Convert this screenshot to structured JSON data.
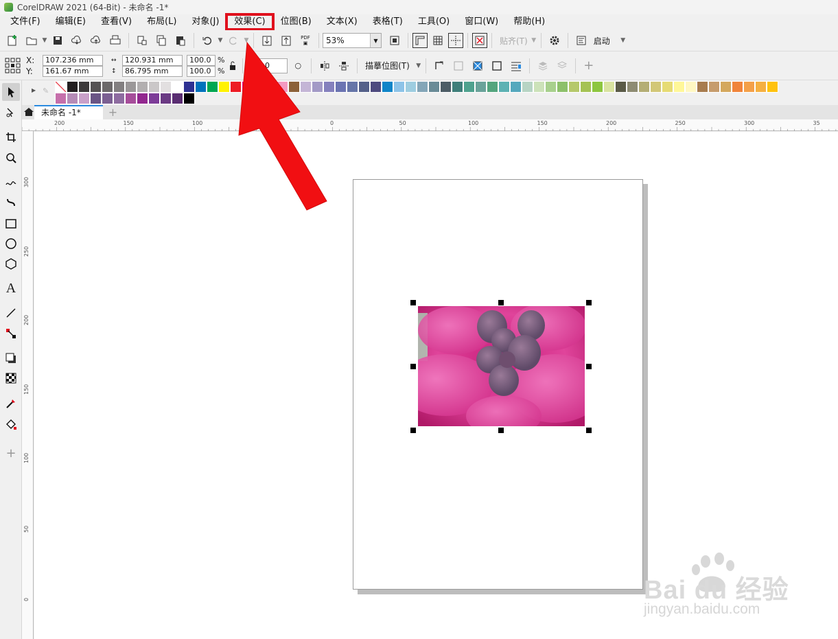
{
  "window": {
    "title": "CorelDRAW 2021 (64-Bit) - 未命名 -1*"
  },
  "menu": [
    {
      "label": "文件(F)"
    },
    {
      "label": "编辑(E)"
    },
    {
      "label": "查看(V)"
    },
    {
      "label": "布局(L)"
    },
    {
      "label": "对象(J)"
    },
    {
      "label": "效果(C)",
      "highlighted": true
    },
    {
      "label": "位图(B)"
    },
    {
      "label": "文本(X)"
    },
    {
      "label": "表格(T)"
    },
    {
      "label": "工具(O)"
    },
    {
      "label": "窗口(W)"
    },
    {
      "label": "帮助(H)"
    }
  ],
  "toolbar": {
    "zoom": "53%",
    "pdf_label": "PDF",
    "snap_label": "贴齐(T)",
    "launch_label": "启动"
  },
  "property_bar": {
    "x_label": "X:",
    "x": "107.236 mm",
    "y_label": "Y:",
    "y": "161.67 mm",
    "width": "120.931 mm",
    "height": "86.795 mm",
    "scale_w": "100.0",
    "scale_h": "100.0",
    "percent": "%",
    "rotation": "0.0",
    "trace_label": "描摹位图(T)"
  },
  "document_tab": {
    "label": "未命名 -1*"
  },
  "ruler": {
    "h_ticks": [
      "200",
      "150",
      "100",
      "50",
      "0",
      "50",
      "100",
      "150",
      "200",
      "250",
      "300",
      "35"
    ],
    "v_ticks": [
      "300",
      "250",
      "200",
      "150",
      "100",
      "50",
      "0"
    ]
  },
  "palette": {
    "row1": [
      "#231f20",
      "#3d3a3b",
      "#555253",
      "#6c696a",
      "#838081",
      "#9b9899",
      "#b2afb0",
      "#cac7c8",
      "#e2dfe0",
      "#ffffff",
      "#2e3192",
      "#0072bc",
      "#00a651",
      "#fff200",
      "#ed1c24",
      "#ec008c",
      "#f26522",
      "#f7941d",
      "#f49ac1",
      "#8c6239",
      "#c4b5d6",
      "#a39ac6",
      "#8581bd",
      "#6b74b2",
      "#6675a8",
      "#556189",
      "#4e4b7f",
      "#0f85c8",
      "#8dc3e8",
      "#9ecde0",
      "#84a6b8",
      "#6a8b97",
      "#4d5d66",
      "#3f7f7a",
      "#4fa28e",
      "#6aa39a",
      "#54a57e",
      "#5db2b3",
      "#55a8bd",
      "#b7d4c4",
      "#cce2b9",
      "#a8d08d",
      "#8dc06b",
      "#b5c86b",
      "#a5c254",
      "#8dc63f",
      "#d9e3a0",
      "#5b5b47",
      "#8e8c73",
      "#b4ae75",
      "#d2c777",
      "#e6db74",
      "#fff799",
      "#fff7c2",
      "#a87c4f",
      "#c69c6d",
      "#d4a85e",
      "#f0843a",
      "#f4a048",
      "#f5b041",
      "#ffc20e"
    ],
    "row2": [
      "#c670ab",
      "#b68bb7",
      "#c9a0c9",
      "#6a5585",
      "#7b5f92",
      "#8e6ca0",
      "#a64d9a",
      "#92278f",
      "#7d3c98",
      "#6b3a84",
      "#5a2d72",
      "#000000"
    ]
  },
  "watermark": {
    "brand": "Bai du 经验",
    "url": "jingyan.baidu.com"
  }
}
